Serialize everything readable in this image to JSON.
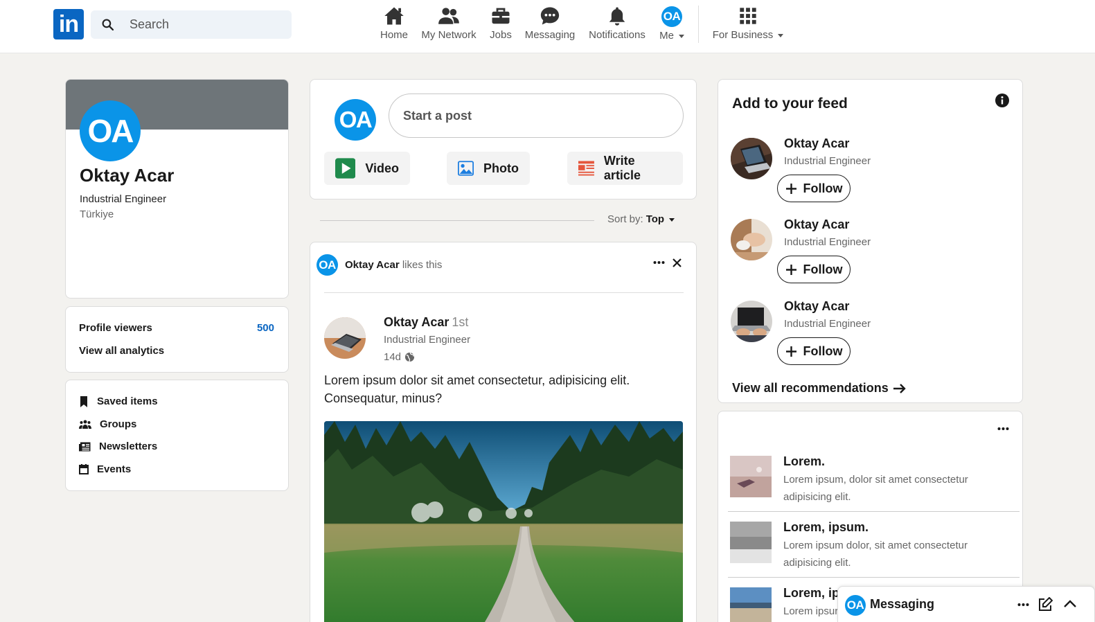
{
  "brand": {
    "logo_text": "in",
    "color": "#0a66c2"
  },
  "search": {
    "placeholder": "Search"
  },
  "nav": {
    "home": "Home",
    "network": "My Network",
    "jobs": "Jobs",
    "messaging": "Messaging",
    "notifications": "Notifications",
    "me": "Me",
    "me_initials": "OA",
    "business": "For Business"
  },
  "profile": {
    "initials": "OA",
    "name": "Oktay Acar",
    "title": "Industrial Engineer",
    "location": "Türkiye",
    "viewers_label": "Profile viewers",
    "viewers_count": "500",
    "analytics_label": "View all analytics",
    "links": [
      "Saved items",
      "Groups",
      "Newsletters",
      "Events"
    ]
  },
  "composer": {
    "initials": "OA",
    "placeholder": "Start a post",
    "video": "Video",
    "photo": "Photo",
    "article": "Write article"
  },
  "sort": {
    "label": "Sort by:",
    "value": "Top"
  },
  "post": {
    "liker_initials": "OA",
    "liker_name": "Oktay Acar",
    "liker_action": "likes this",
    "author_name": "Oktay Acar",
    "author_degree": "1st",
    "author_title": "Industrial Engineer",
    "time": "14d",
    "text": "Lorem ipsum dolor sit amet consectetur, adipisicing elit. Consequatur, minus?"
  },
  "feed": {
    "title": "Add to your feed",
    "items": [
      {
        "name": "Oktay Acar",
        "title": "Industrial Engineer",
        "button": "Follow"
      },
      {
        "name": "Oktay Acar",
        "title": "Industrial Engineer",
        "button": "Follow"
      },
      {
        "name": "Oktay Acar",
        "title": "Industrial Engineer",
        "button": "Follow"
      }
    ],
    "view_all": "View all recommendations"
  },
  "news": [
    {
      "title": "Lorem.",
      "desc": "Lorem ipsum, dolor sit amet consectetur adipisicing elit."
    },
    {
      "title": "Lorem, ipsum.",
      "desc": "Lorem ipsum dolor, sit amet consectetur adipisicing elit."
    },
    {
      "title": "Lorem, ip",
      "desc": "Lorem ipsur"
    }
  ],
  "messaging": {
    "initials": "OA",
    "label": "Messaging"
  }
}
